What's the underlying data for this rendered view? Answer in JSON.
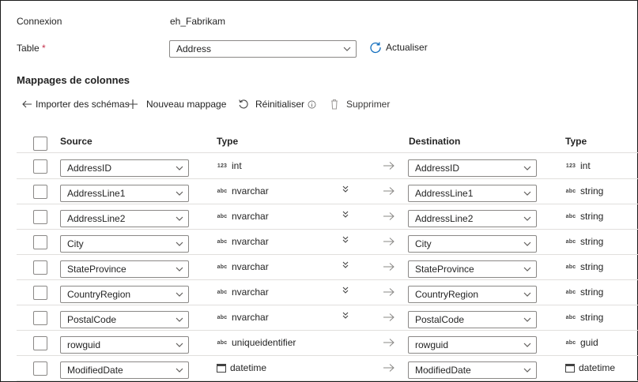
{
  "connection": {
    "label": "Connexion",
    "value": "eh_Fabrikam"
  },
  "table": {
    "label": "Table",
    "required": "*",
    "value": "Address",
    "refresh_label": "Actualiser"
  },
  "mappings": {
    "title": "Mappages de colonnes",
    "toolbar": {
      "import_label": "Importer des schémas",
      "new_label": "Nouveau mappage",
      "reset_label": "Réinitialiser",
      "delete_label": "Supprimer"
    },
    "headers": {
      "source": "Source",
      "type": "Type",
      "destination": "Destination",
      "dtype": "Type"
    },
    "rows": [
      {
        "source": "AddressID",
        "type": "int",
        "type_icon": "123",
        "dest": "AddressID",
        "dtype": "int",
        "dtype_icon": "123",
        "expand": false
      },
      {
        "source": "AddressLine1",
        "type": "nvarchar",
        "type_icon": "abc",
        "dest": "AddressLine1",
        "dtype": "string",
        "dtype_icon": "abc",
        "expand": true
      },
      {
        "source": "AddressLine2",
        "type": "nvarchar",
        "type_icon": "abc",
        "dest": "AddressLine2",
        "dtype": "string",
        "dtype_icon": "abc",
        "expand": true
      },
      {
        "source": "City",
        "type": "nvarchar",
        "type_icon": "abc",
        "dest": "City",
        "dtype": "string",
        "dtype_icon": "abc",
        "expand": true
      },
      {
        "source": "StateProvince",
        "type": "nvarchar",
        "type_icon": "abc",
        "dest": "StateProvince",
        "dtype": "string",
        "dtype_icon": "abc",
        "expand": true
      },
      {
        "source": "CountryRegion",
        "type": "nvarchar",
        "type_icon": "abc",
        "dest": "CountryRegion",
        "dtype": "string",
        "dtype_icon": "abc",
        "expand": true
      },
      {
        "source": "PostalCode",
        "type": "nvarchar",
        "type_icon": "abc",
        "dest": "PostalCode",
        "dtype": "string",
        "dtype_icon": "abc",
        "expand": true
      },
      {
        "source": "rowguid",
        "type": "uniqueidentifier",
        "type_icon": "abc",
        "dest": "rowguid",
        "dtype": "guid",
        "dtype_icon": "abc",
        "expand": false
      },
      {
        "source": "ModifiedDate",
        "type": "datetime",
        "type_icon": "calendar-icon",
        "dest": "ModifiedDate",
        "dtype": "datetime",
        "dtype_icon": "calendar-icon",
        "expand": false
      }
    ]
  }
}
